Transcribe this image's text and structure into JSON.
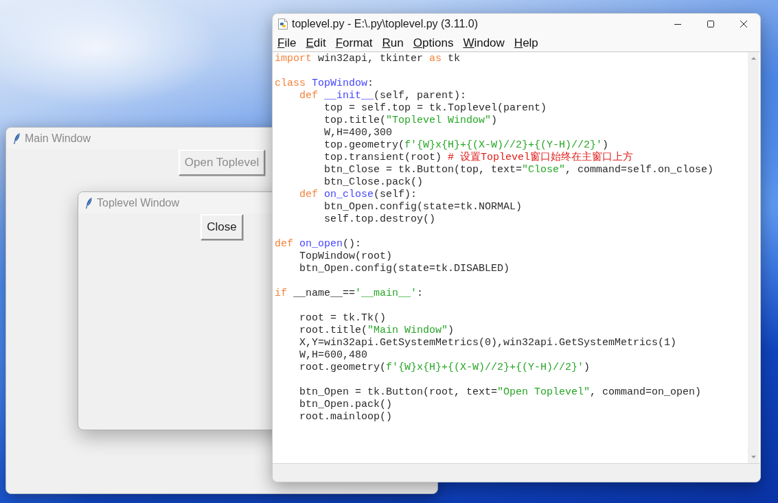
{
  "main_window": {
    "title": "Main Window",
    "active": false,
    "button": {
      "label": "Open Toplevel",
      "disabled": true
    }
  },
  "toplevel_window": {
    "title": "Toplevel Window",
    "active": false,
    "button": {
      "label": "Close",
      "disabled": false
    }
  },
  "editor_window": {
    "title": "toplevel.py - E:\\.py\\toplevel.py (3.11.0)",
    "active": true,
    "menu": [
      "File",
      "Edit",
      "Format",
      "Run",
      "Options",
      "Window",
      "Help"
    ],
    "lines": [
      {
        "kind": "code",
        "tokens": [
          {
            "kind": "keyword",
            "text": "import"
          },
          {
            "kind": "plain",
            "text": " win32api, tkinter "
          },
          {
            "kind": "keyword",
            "text": "as"
          },
          {
            "kind": "plain",
            "text": " tk"
          }
        ]
      },
      {
        "kind": "blank"
      },
      {
        "kind": "code",
        "tokens": [
          {
            "kind": "keyword",
            "text": "class "
          },
          {
            "kind": "definition",
            "text": "TopWindow"
          },
          {
            "kind": "plain",
            "text": ":"
          }
        ],
        "children": [
          {
            "kind": "code",
            "tokens": [
              {
                "kind": "keyword",
                "text": "def "
              },
              {
                "kind": "definition",
                "text": "__init__"
              },
              {
                "kind": "plain",
                "text": "(self, parent):"
              }
            ],
            "children": [
              {
                "kind": "code",
                "tokens": [
                  {
                    "kind": "plain",
                    "text": "top = self.top = tk.Toplevel(parent)"
                  }
                ]
              },
              {
                "kind": "code",
                "tokens": [
                  {
                    "kind": "plain",
                    "text": "top.title("
                  },
                  {
                    "kind": "string",
                    "text": "\"Toplevel Window\""
                  },
                  {
                    "kind": "plain",
                    "text": ")"
                  }
                ]
              },
              {
                "kind": "code",
                "tokens": [
                  {
                    "kind": "plain",
                    "text": "W,H=400,300"
                  }
                ]
              },
              {
                "kind": "code",
                "tokens": [
                  {
                    "kind": "plain",
                    "text": "top.geometry("
                  },
                  {
                    "kind": "string",
                    "text": "f'{W}x{H}+{(X-W)//2}+{(Y-H)//2}'"
                  },
                  {
                    "kind": "plain",
                    "text": ")"
                  }
                ]
              },
              {
                "kind": "code",
                "tokens": [
                  {
                    "kind": "plain",
                    "text": "top.transient(root) "
                  },
                  {
                    "kind": "comment",
                    "text": "# 设置Toplevel窗口始终在主窗口上方"
                  }
                ]
              },
              {
                "kind": "code",
                "tokens": [
                  {
                    "kind": "plain",
                    "text": "btn_Close = tk.Button(top, text="
                  },
                  {
                    "kind": "string",
                    "text": "\"Close\""
                  },
                  {
                    "kind": "plain",
                    "text": ", command=self.on_close)"
                  }
                ]
              },
              {
                "kind": "code",
                "tokens": [
                  {
                    "kind": "plain",
                    "text": "btn_Close.pack()"
                  }
                ]
              }
            ]
          },
          {
            "kind": "code",
            "tokens": [
              {
                "kind": "keyword",
                "text": "def "
              },
              {
                "kind": "definition",
                "text": "on_close"
              },
              {
                "kind": "plain",
                "text": "(self):"
              }
            ],
            "children": [
              {
                "kind": "code",
                "tokens": [
                  {
                    "kind": "plain",
                    "text": "btn_Open.config(state=tk.NORMAL)"
                  }
                ]
              },
              {
                "kind": "code",
                "tokens": [
                  {
                    "kind": "plain",
                    "text": "self.top.destroy()"
                  }
                ]
              }
            ]
          }
        ]
      },
      {
        "kind": "blank"
      },
      {
        "kind": "code",
        "tokens": [
          {
            "kind": "keyword",
            "text": "def "
          },
          {
            "kind": "definition",
            "text": "on_open"
          },
          {
            "kind": "plain",
            "text": "():"
          }
        ],
        "children": [
          {
            "kind": "code",
            "tokens": [
              {
                "kind": "plain",
                "text": "TopWindow(root)"
              }
            ]
          },
          {
            "kind": "code",
            "tokens": [
              {
                "kind": "plain",
                "text": "btn_Open.config(state=tk.DISABLED)"
              }
            ]
          }
        ]
      },
      {
        "kind": "blank"
      },
      {
        "kind": "code",
        "tokens": [
          {
            "kind": "keyword",
            "text": "if"
          },
          {
            "kind": "plain",
            "text": " __name__=="
          },
          {
            "kind": "string",
            "text": "'__main__'"
          },
          {
            "kind": "plain",
            "text": ":"
          }
        ],
        "children": [
          {
            "kind": "blank"
          },
          {
            "kind": "code",
            "tokens": [
              {
                "kind": "plain",
                "text": "root = tk.Tk()"
              }
            ]
          },
          {
            "kind": "code",
            "tokens": [
              {
                "kind": "plain",
                "text": "root.title("
              },
              {
                "kind": "string",
                "text": "\"Main Window\""
              },
              {
                "kind": "plain",
                "text": ")"
              }
            ]
          },
          {
            "kind": "code",
            "tokens": [
              {
                "kind": "plain",
                "text": "X,Y=win32api.GetSystemMetrics(0),win32api.GetSystemMetrics(1)"
              }
            ]
          },
          {
            "kind": "code",
            "tokens": [
              {
                "kind": "plain",
                "text": "W,H=600,480"
              }
            ]
          },
          {
            "kind": "code",
            "tokens": [
              {
                "kind": "plain",
                "text": "root.geometry("
              },
              {
                "kind": "string",
                "text": "f'{W}x{H}+{(X-W)//2}+{(Y-H)//2}'"
              },
              {
                "kind": "plain",
                "text": ")"
              }
            ]
          },
          {
            "kind": "blank"
          },
          {
            "kind": "code",
            "tokens": [
              {
                "kind": "plain",
                "text": "btn_Open = tk.Button(root, text="
              },
              {
                "kind": "string",
                "text": "\"Open Toplevel\""
              },
              {
                "kind": "plain",
                "text": ", command=on_open)"
              }
            ]
          },
          {
            "kind": "code",
            "tokens": [
              {
                "kind": "plain",
                "text": "btn_Open.pack()"
              }
            ]
          },
          {
            "kind": "code",
            "tokens": [
              {
                "kind": "plain",
                "text": "root.mainloop()"
              }
            ]
          }
        ]
      }
    ]
  }
}
